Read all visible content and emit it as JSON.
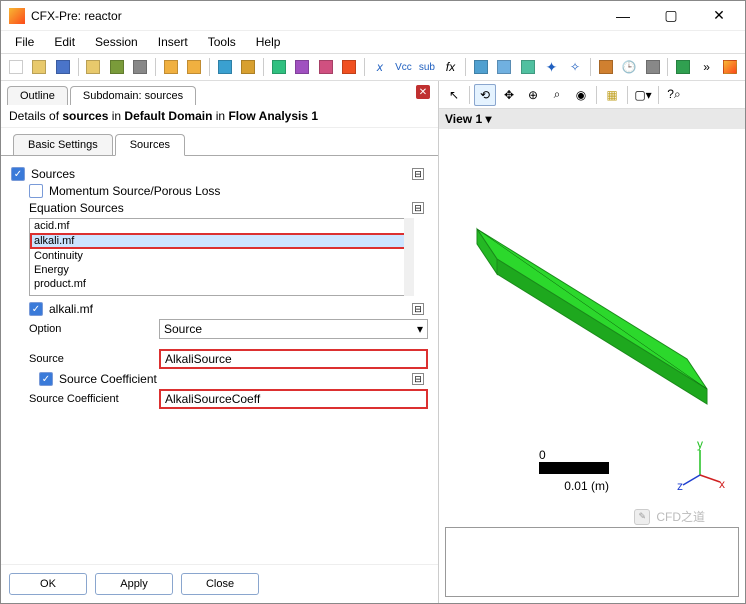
{
  "title": "CFX-Pre:  reactor",
  "menus": [
    "File",
    "Edit",
    "Session",
    "Insert",
    "Tools",
    "Help"
  ],
  "outline_tabs": {
    "outline": "Outline",
    "subdomain": "Subdomain: sources"
  },
  "details_header": {
    "prefix": "Details of ",
    "b1": "sources",
    "m1": " in ",
    "b2": "Default Domain",
    "m2": " in ",
    "b3": "Flow Analysis 1"
  },
  "sub_tabs": {
    "basic": "Basic Settings",
    "sources": "Sources"
  },
  "form": {
    "sources_label": "Sources",
    "momentum_label": "Momentum Source/Porous Loss",
    "eq_sources_label": "Equation Sources",
    "list_items": [
      "acid.mf",
      "alkali.mf",
      "Continuity",
      "Energy",
      "product.mf"
    ],
    "list_selected": "alkali.mf",
    "alkali_label": "alkali.mf",
    "option_label": "Option",
    "option_value": "Source",
    "source_label": "Source",
    "source_value": "AlkaliSource",
    "coeff_check_label": "Source Coefficient",
    "coeff_label": "Source Coefficient",
    "coeff_value": "AlkaliSourceCoeff"
  },
  "buttons": {
    "ok": "OK",
    "apply": "Apply",
    "close": "Close"
  },
  "view_tab": "View 1 ▾",
  "scale": {
    "zero": "0",
    "len": "0.01",
    "unit": "(m)"
  },
  "triad": {
    "x": "x",
    "y": "y",
    "z": "z"
  },
  "watermark": "CFD之道",
  "colors": {
    "accent": "#3a7ad9",
    "red": "#dc3030",
    "geom": "#2cd82c"
  }
}
